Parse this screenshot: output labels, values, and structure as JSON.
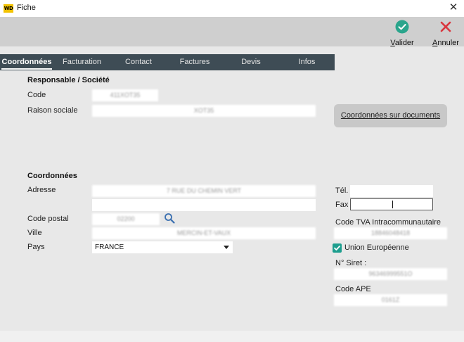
{
  "window": {
    "icon_text": "WD",
    "title": "Fiche",
    "close": "✕"
  },
  "toolbar": {
    "validate_label": "Valider",
    "cancel_label": "Annuler",
    "accent_ok": "#2aa58c",
    "accent_cancel": "#d9363e"
  },
  "tabs": [
    {
      "label": "Coordonnées",
      "active": true
    },
    {
      "label": "Facturation",
      "active": false
    },
    {
      "label": "Contact",
      "active": false
    },
    {
      "label": "Factures",
      "active": false
    },
    {
      "label": "Devis",
      "active": false
    },
    {
      "label": "Infos",
      "active": false
    }
  ],
  "responsable": {
    "section_title": "Responsable / Société",
    "code_label": "Code",
    "code_value": "411XOT35",
    "raison_label": "Raison sociale",
    "raison_value": "XOT35"
  },
  "coord_docs_button": "Coordonnées sur documents",
  "coordonnees": {
    "section_title": "Coordonnées",
    "adresse_label": "Adresse",
    "adresse_line1": "7 RUE DU CHEMIN VERT",
    "adresse_line2": "",
    "cp_label": "Code postal",
    "cp_value": "02200",
    "ville_label": "Ville",
    "ville_value": "MERCIN-ET-VAUX",
    "pays_label": "Pays",
    "pays_value": "FRANCE"
  },
  "right_panel": {
    "tel_label": "Tél.",
    "tel_value": "",
    "fax_label": "Fax",
    "fax_value": "",
    "tva_label": "Code TVA Intracommunautaire",
    "tva_value": "18846048418",
    "ue_label": "Union Européenne",
    "ue_checked": true,
    "siret_label": "N° Siret :",
    "siret_value": "96346999551O",
    "ape_label": "Code APE",
    "ape_value": "0161Z"
  }
}
